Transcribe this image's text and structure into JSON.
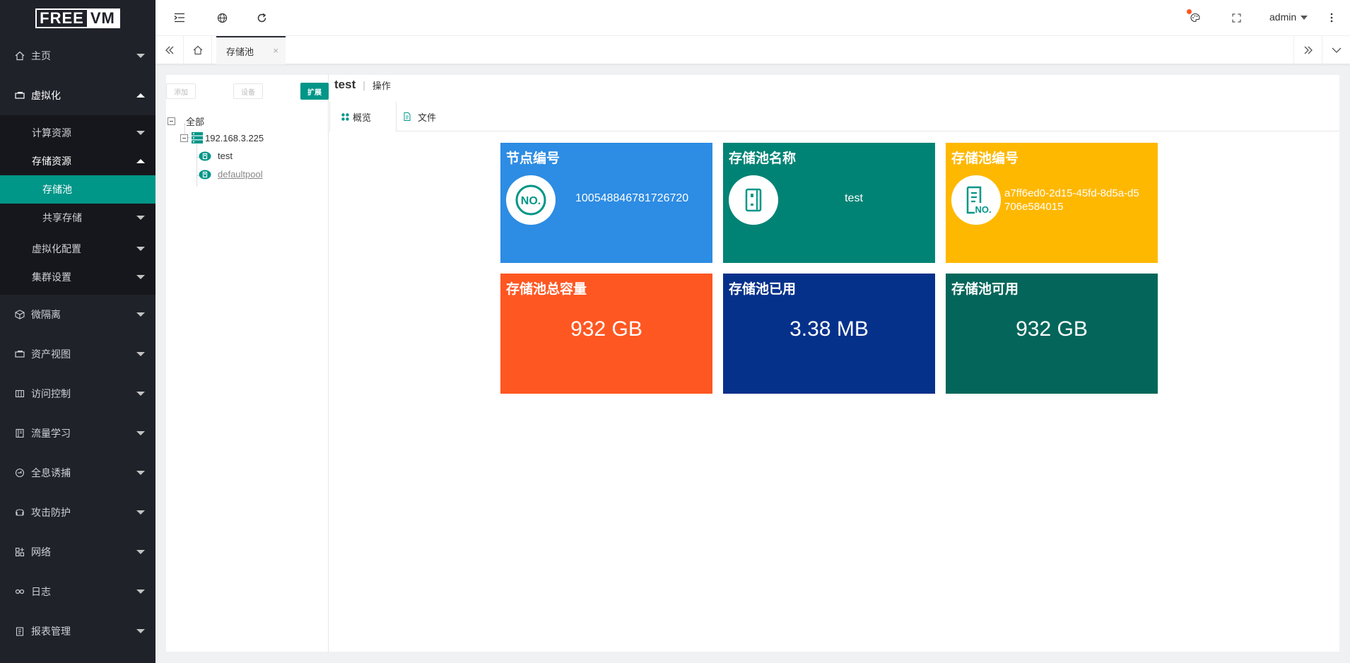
{
  "app": {
    "logo_left": "FREE",
    "logo_right": "VM"
  },
  "sidebar": {
    "home": "主页",
    "virtualization": "虚拟化",
    "compute": "计算资源",
    "storage": "存储资源",
    "storage_pool": "存储池",
    "shared_storage": "共享存储",
    "virt_config": "虚拟化配置",
    "cluster": "集群设置",
    "micro_isolation": "微隔离",
    "asset_view": "资产视图",
    "access_control": "访问控制",
    "traffic_learning": "流量学习",
    "honeypot": "全息诱捕",
    "attack_defense": "攻击防护",
    "network": "网络",
    "log": "日志",
    "report": "报表管理"
  },
  "header": {
    "user": "admin"
  },
  "tabs": {
    "current": "存储池",
    "close": "×"
  },
  "toolbar": {
    "add": "添加",
    "settings": "设备",
    "expand": "扩展"
  },
  "tree": {
    "root": "全部",
    "host": "192.168.3.225",
    "pool1": "test",
    "pool2": "defaultpool"
  },
  "detail": {
    "title": "test",
    "separator": "|",
    "operation": "操作",
    "tab_overview": "概览",
    "tab_files": "文件"
  },
  "cards": {
    "node_id_title": "节点编号",
    "node_id_value": "100548846781726720",
    "pool_name_title": "存储池名称",
    "pool_name_value": "test",
    "pool_id_title": "存储池编号",
    "pool_id_value_1": "a7ff6ed0-2d15-45fd-8d5a-d5",
    "pool_id_value_2": "706e584015",
    "total_title": "存储池总容量",
    "total_value": "932 GB",
    "used_title": "存储池已用",
    "used_value": "3.38 MB",
    "free_title": "存储池可用",
    "free_value": "932 GB"
  },
  "colors": {
    "sidebar_bg": "#20222a",
    "accent": "#009688",
    "card_blue": "#2d8ce3",
    "card_teal": "#008375",
    "card_yellow": "#ffb800",
    "card_orange": "#ff5722",
    "card_navy": "#06318b",
    "card_green": "#04665a"
  }
}
